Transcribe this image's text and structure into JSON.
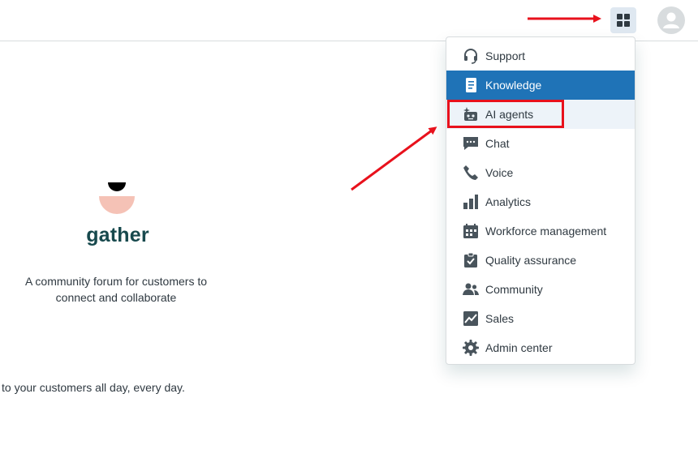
{
  "brand": {
    "name": "gather",
    "tagline": "A community forum for customers to connect and collaborate"
  },
  "partial_text": "to your customers all day, every day.",
  "header": {
    "apps_button_icon": "grid-icon",
    "avatar_icon": "user-icon"
  },
  "menu": {
    "items": [
      {
        "label": "Support",
        "icon": "headset-icon"
      },
      {
        "label": "Knowledge",
        "icon": "book-icon",
        "state": "selected"
      },
      {
        "label": "AI agents",
        "icon": "robot-icon",
        "state": "hovered"
      },
      {
        "label": "Chat",
        "icon": "chat-icon"
      },
      {
        "label": "Voice",
        "icon": "phone-icon"
      },
      {
        "label": "Analytics",
        "icon": "bar-chart-icon"
      },
      {
        "label": "Workforce management",
        "icon": "calendar-icon"
      },
      {
        "label": "Quality assurance",
        "icon": "clipboard-check-icon"
      },
      {
        "label": "Community",
        "icon": "people-icon"
      },
      {
        "label": "Sales",
        "icon": "trend-icon"
      },
      {
        "label": "Admin center",
        "icon": "gear-icon"
      }
    ]
  },
  "colors": {
    "accent": "#1f73b7",
    "annotation": "#e8111c",
    "brand_text": "#17494d"
  }
}
